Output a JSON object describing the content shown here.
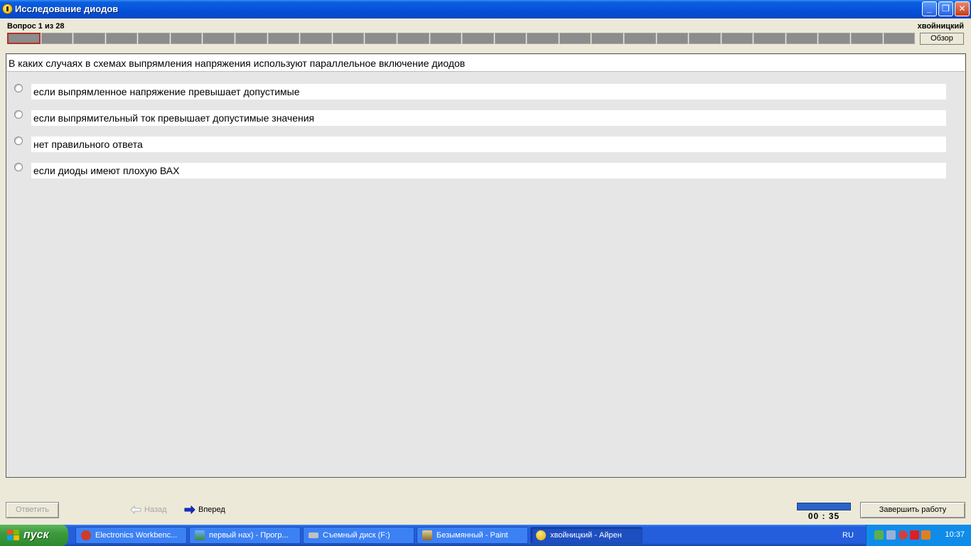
{
  "window": {
    "title": "Исследование диодов",
    "controls": {
      "minimize": "_",
      "maximize": "❐",
      "close": "✕"
    }
  },
  "header": {
    "question_counter": "Вопрос 1 из 28",
    "user": "хвойницкий",
    "overview_label": "Обзор",
    "segments_total": 28,
    "current_segment": 1
  },
  "question": {
    "text": "В каких случаях в схемах выпрямления напряжения используют параллельное включение диодов"
  },
  "answers": [
    "если выпрямленное напряжение превышает допустимые",
    "если выпрямительный ток превышает допустимые значения",
    "нет правильного ответа",
    "если диоды имеют плохую ВАХ"
  ],
  "footer": {
    "answer_label": "Ответить",
    "back_label": "Назад",
    "forward_label": "Вперед",
    "timer": "00 : 35",
    "finish_label": "Завершить работу"
  },
  "taskbar": {
    "start_label": "пуск",
    "tasks": [
      {
        "label": "Electronics Workbenc...",
        "icon": "electronics-workbench-icon",
        "color": "#d03a2a"
      },
      {
        "label": "первый нах) - Прогр...",
        "icon": "image-viewer-icon",
        "color": "#3a8a3a"
      },
      {
        "label": "Съемный диск (F:)",
        "icon": "removable-disk-icon",
        "color": "#c0c0c0"
      },
      {
        "label": "Безымянный - Paint",
        "icon": "paint-icon",
        "color": "#d8c070"
      },
      {
        "label": "хвойницкий - Айрен",
        "icon": "test-app-icon",
        "color": "#f2c200"
      }
    ],
    "language": "RU",
    "clock": "10:37"
  }
}
